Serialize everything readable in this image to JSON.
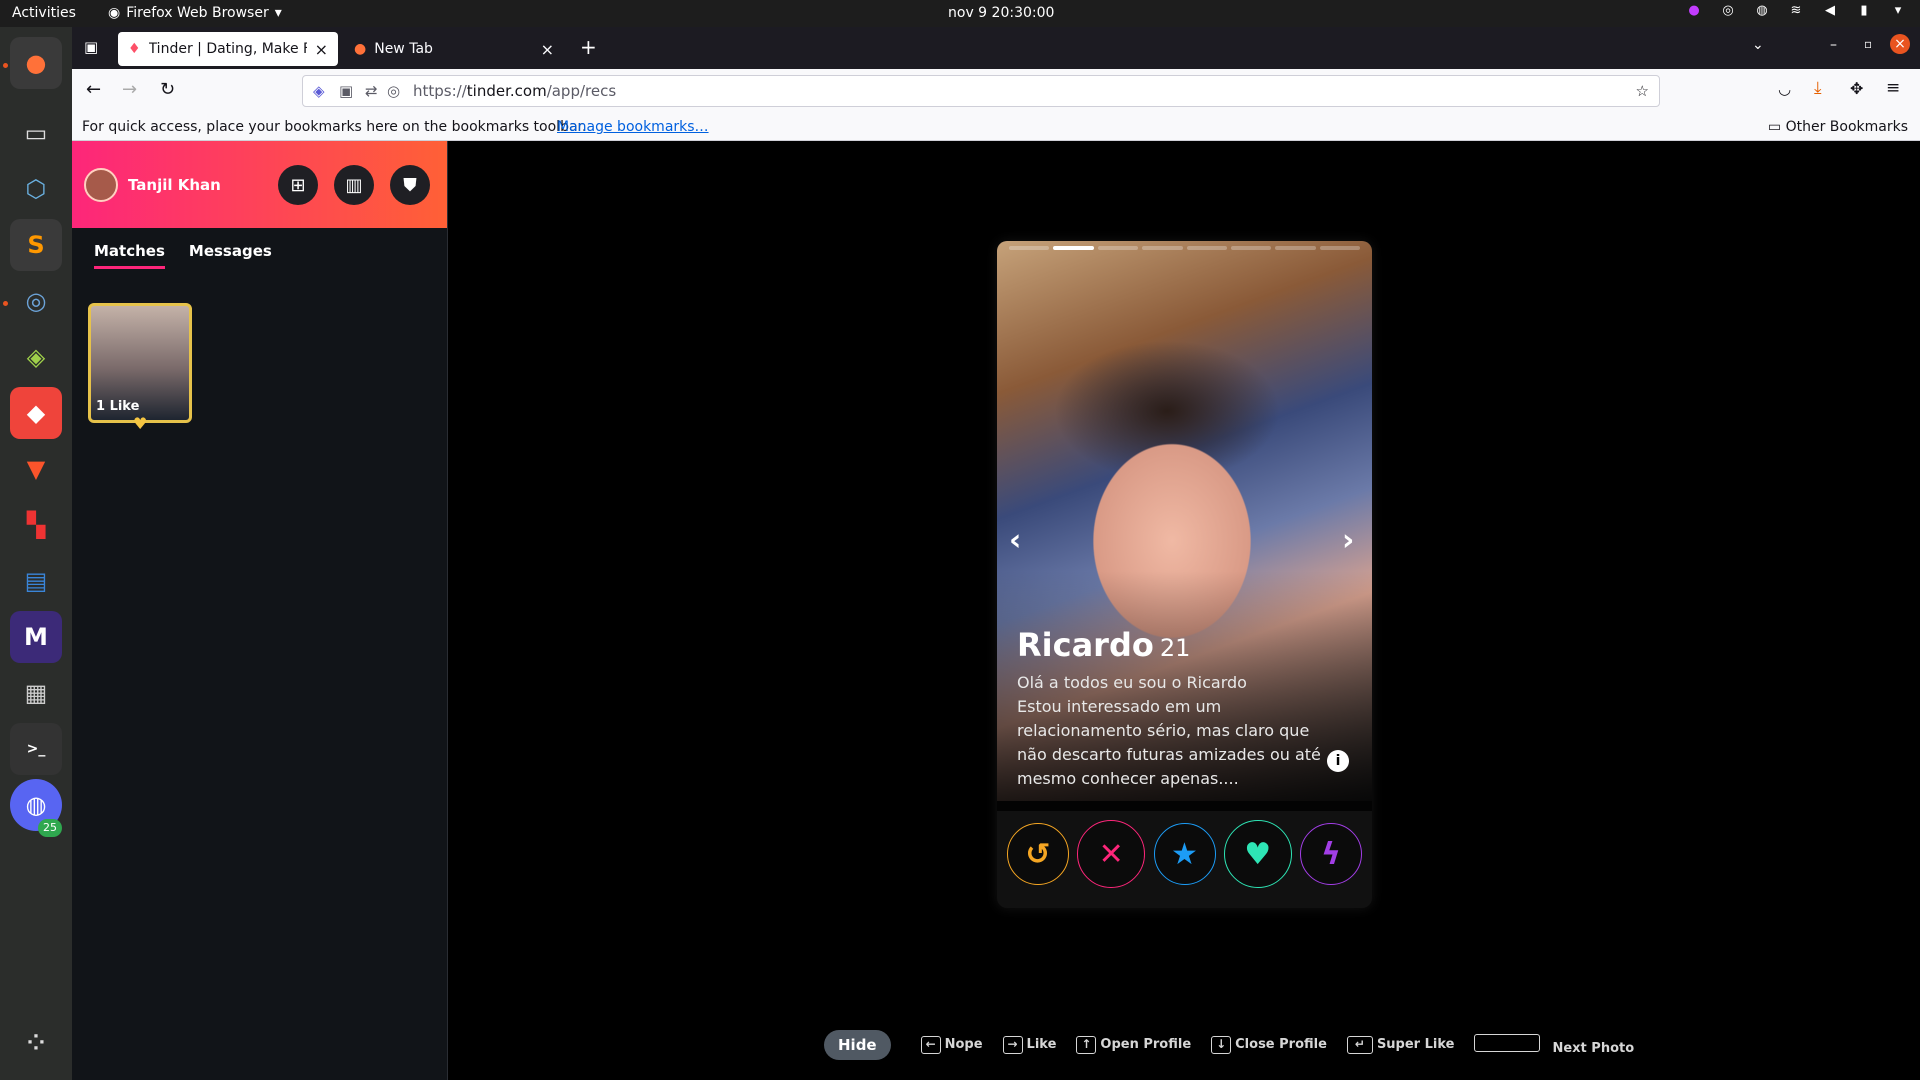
{
  "system": {
    "activities": "Activities",
    "app_name": "Firefox Web Browser",
    "clock": "nov 9  20:30:00"
  },
  "dock": {
    "badge_count": "25",
    "items": [
      "firefox",
      "files",
      "virtualbox",
      "sublime-text",
      "steam",
      "gis-app",
      "anydesk",
      "brave",
      "mixed-app",
      "writer",
      "m-app",
      "calculator",
      "terminal",
      "discord",
      "app-grid"
    ]
  },
  "browser": {
    "tabs": [
      {
        "title": "Tinder | Dating, Make Fri",
        "icon": "tinder-flame-icon"
      },
      {
        "title": "New Tab",
        "icon": "firefox-icon"
      }
    ],
    "url_prefix": "https://",
    "url_host": "tinder.com",
    "url_path": "/app/recs",
    "bookmarks_hint": "For quick access, place your bookmarks here on the bookmarks toolbar.",
    "manage_bookmarks": "Manage bookmarks…",
    "other_bookmarks": "Other Bookmarks"
  },
  "sidebar": {
    "user_name": "Tanjil Khan",
    "tabs": [
      "Matches",
      "Messages"
    ],
    "active_tab": "Matches",
    "likes_label": "1 Like"
  },
  "profile": {
    "name": "Ricardo",
    "age": "21",
    "bio_line1": "Olá a todos eu sou o Ricardo",
    "bio_line2": "Estou interessado em um relacionamento sério, mas claro que não descarto futuras amizades ou até mesmo conhecer apenas....",
    "photo_count": 8,
    "photo_index": 2
  },
  "actions": [
    {
      "name": "rewind",
      "color": "#f5a623"
    },
    {
      "name": "nope",
      "color": "#fd267a"
    },
    {
      "name": "super-like",
      "color": "#1c9cf6"
    },
    {
      "name": "like",
      "color": "#2ee5b5"
    },
    {
      "name": "boost",
      "color": "#a23ee6"
    }
  ],
  "shortcuts": {
    "hide": "Hide",
    "nope": "Nope",
    "like": "Like",
    "open_profile": "Open Profile",
    "close_profile": "Close Profile",
    "super_like": "Super Like",
    "next_photo": "Next Photo"
  }
}
